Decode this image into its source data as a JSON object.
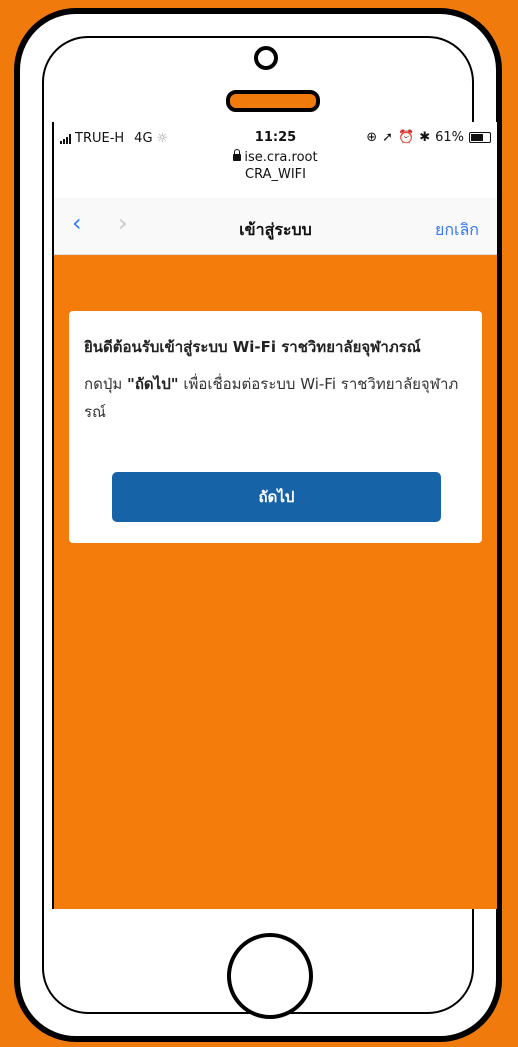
{
  "status_bar": {
    "carrier": "TRUE-H",
    "network": "4G",
    "time": "11:25",
    "battery": "61%",
    "battery_level": 0.61,
    "icons": [
      "signal-icon",
      "activity-icon",
      "lock-rotation-icon",
      "location-icon",
      "alarm-icon",
      "bluetooth-icon",
      "battery-icon"
    ]
  },
  "browser": {
    "url": "ise.cra.root",
    "ssid": "CRA_WIFI",
    "back_label": "‹",
    "forward_label": "›",
    "title": "เข้าสู่ระบบ",
    "cancel_label": "ยกเลิก"
  },
  "card": {
    "title": "ยินดีต้อนรับเข้าสู่ระบบ Wi-Fi ราชวิทยาลัยจุฬาภรณ์",
    "body_prefix": "กดปุ่ม ",
    "body_bold": "\"ถัดไป\"",
    "body_suffix": " เพื่อเชื่อมต่อระบบ Wi-Fi ราชวิทยาลัยจุฬาภรณ์",
    "button_label": "ถัดไป"
  },
  "colors": {
    "background": "#f07a0c",
    "content_bg": "#f47c0a",
    "button": "#1763a8",
    "link": "#3478f6"
  }
}
